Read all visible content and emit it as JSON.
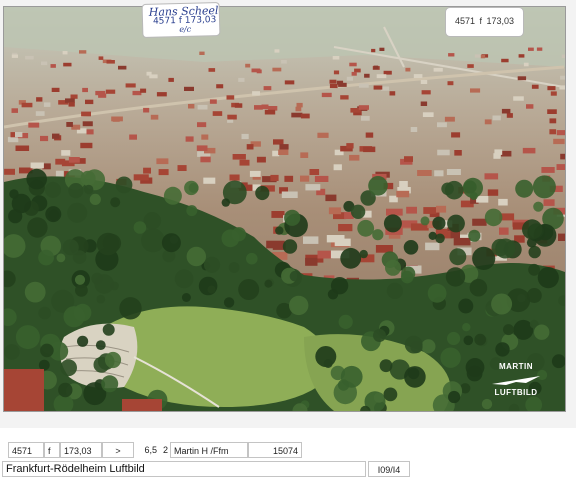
{
  "handwritten_label": {
    "line1": "Hans Scheel",
    "line2": "4571 f 173,03",
    "line3": "e/c"
  },
  "printed_label": "4571 f 173,03",
  "logo": {
    "top": "MARTIN",
    "bottom": "LUFTBILD"
  },
  "info_row": {
    "number": "4571",
    "letter": "f",
    "code": "173,03",
    "arrow": ">",
    "value": "6,5",
    "count": "2",
    "publisher": "Martin H /Ffm",
    "id": "15074"
  },
  "title": "Frankfurt-Rödelheim  Luftbild",
  "date": "I09/I4",
  "colors": {
    "foliage": "#2f5a2a",
    "roofs": "#a64535",
    "lawn": "#8fb05a",
    "sky_haze": "#c9cdbd"
  }
}
